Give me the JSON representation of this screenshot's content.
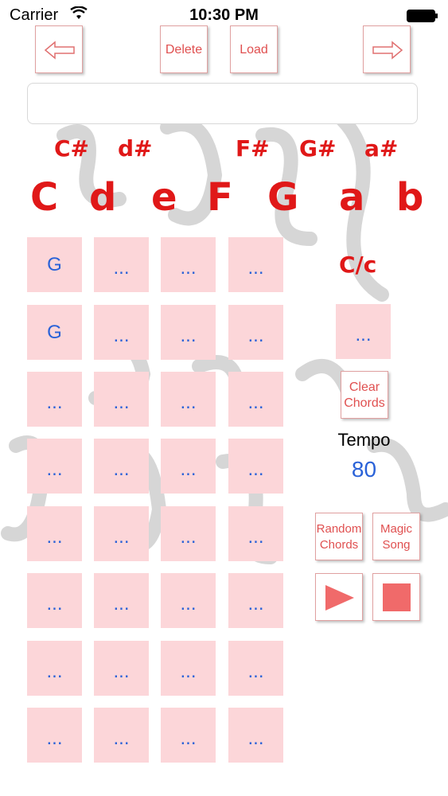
{
  "status": {
    "carrier": "Carrier",
    "time": "10:30 PM"
  },
  "toolbar": {
    "delete_label": "Delete",
    "load_label": "Load"
  },
  "song_name": {
    "value": ""
  },
  "sharps": [
    "C#",
    "d#",
    "F#",
    "G#",
    "a#"
  ],
  "naturals": [
    "C",
    "d",
    "e",
    "F",
    "G",
    "a",
    "b"
  ],
  "chord_grid": [
    [
      "G",
      "...",
      "...",
      "..."
    ],
    [
      "G",
      "...",
      "...",
      "..."
    ],
    [
      "...",
      "...",
      "...",
      "..."
    ],
    [
      "...",
      "...",
      "...",
      "..."
    ],
    [
      "...",
      "...",
      "...",
      "..."
    ],
    [
      "...",
      "...",
      "...",
      "..."
    ],
    [
      "...",
      "...",
      "...",
      "..."
    ],
    [
      "...",
      "...",
      "...",
      "..."
    ]
  ],
  "side": {
    "mode_label": "C/c",
    "current_chord": "...",
    "clear_label_1": "Clear",
    "clear_label_2": "Chords",
    "tempo_label": "Tempo",
    "tempo_value": "80",
    "random_label_1": "Random",
    "random_label_2": "Chords",
    "magic_label_1": "Magic",
    "magic_label_2": "Song"
  },
  "colors": {
    "accent_red": "#e01818",
    "chord_blue": "#2a62d8",
    "cell_pink": "#fcd6d9"
  }
}
